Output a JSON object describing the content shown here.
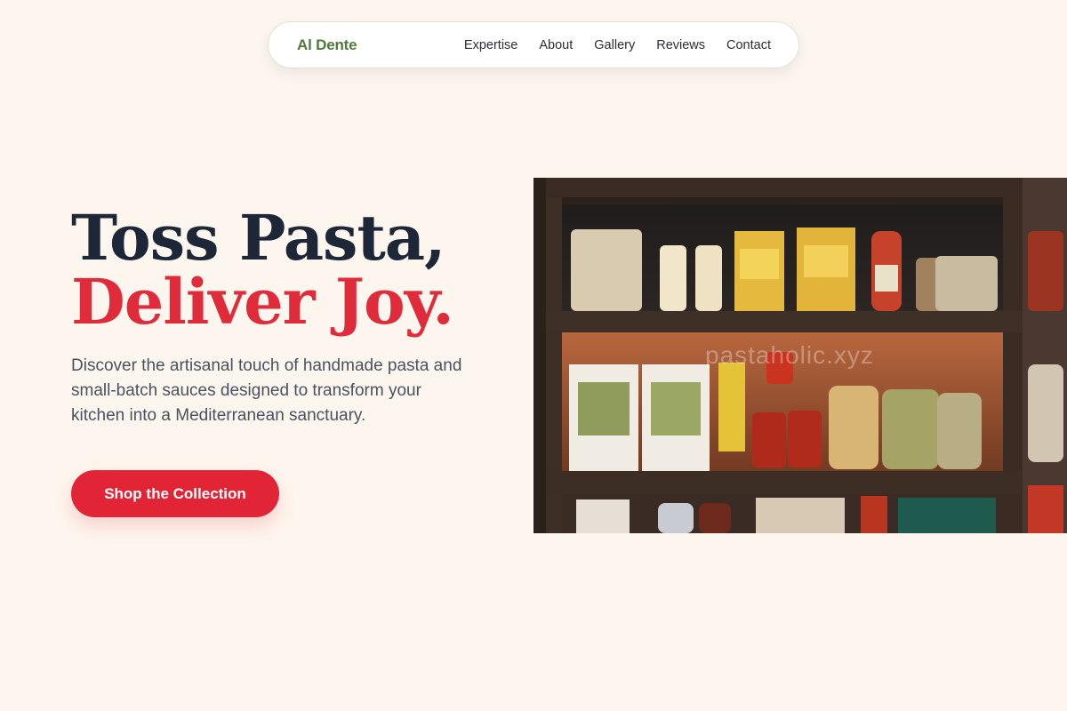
{
  "nav": {
    "brand": "Al Dente",
    "links": [
      "Expertise",
      "About",
      "Gallery",
      "Reviews",
      "Contact"
    ]
  },
  "hero": {
    "title_line1": "Toss Pasta,",
    "title_line2": "Deliver Joy.",
    "description": "Discover the artisanal touch of handmade pasta and small-batch sauces designed to transform your kitchen into a Mediterranean sanctuary.",
    "cta_label": "Shop the Collection",
    "image_watermark": "pastaholic.xyz"
  },
  "colors": {
    "background": "#fdf6ee",
    "brand_green": "#4e7a3a",
    "accent_red": "#e22536",
    "heading_dark": "#1d2738"
  }
}
